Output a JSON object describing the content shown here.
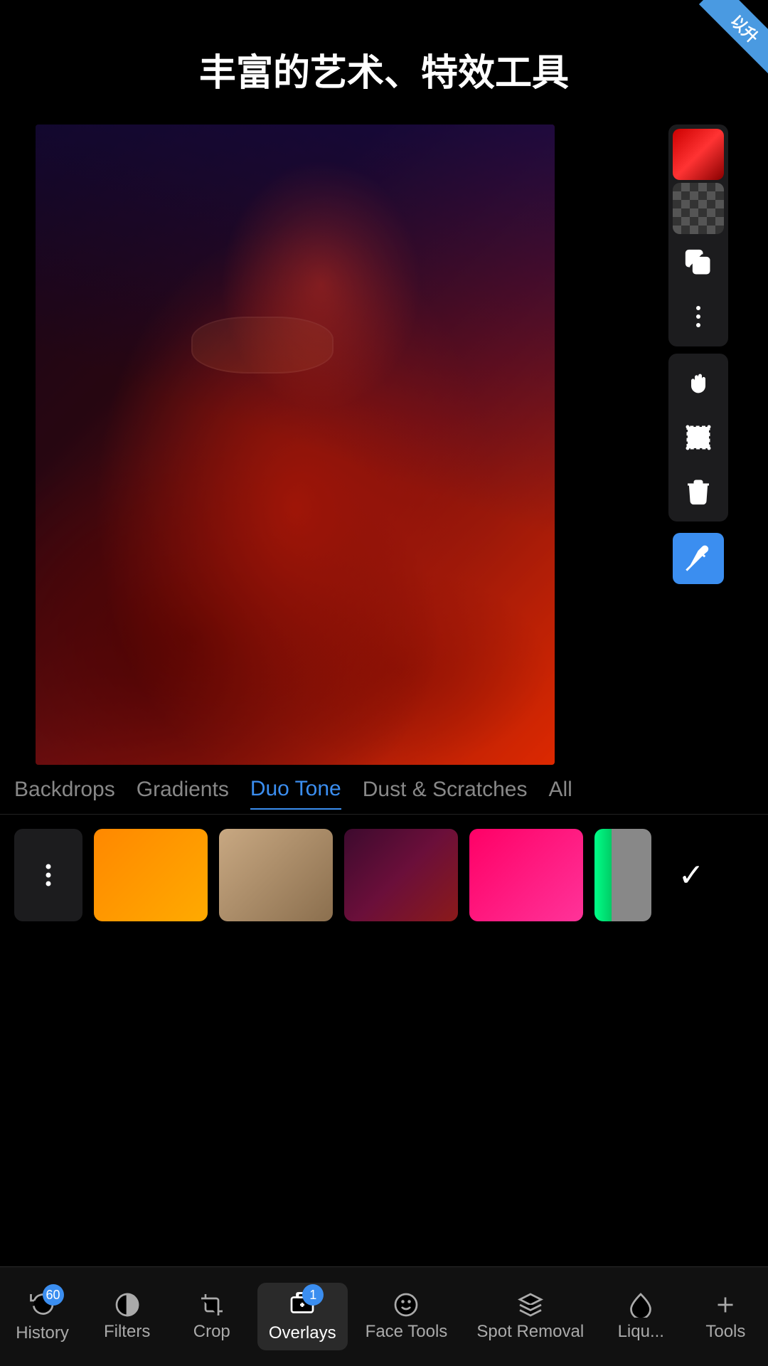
{
  "app": {
    "title": "丰富的艺术、特效工具",
    "badge_text": "以升"
  },
  "sidebar_tools_top": [
    {
      "id": "color-swatch",
      "label": "color swatch red",
      "type": "color"
    },
    {
      "id": "checker",
      "label": "checker pattern",
      "type": "checker"
    },
    {
      "id": "copy",
      "label": "copy layers",
      "type": "copy"
    },
    {
      "id": "more",
      "label": "more options",
      "type": "more"
    }
  ],
  "sidebar_tools_mid": [
    {
      "id": "hand",
      "label": "hand tool",
      "type": "hand"
    },
    {
      "id": "select",
      "label": "selection tool",
      "type": "select"
    },
    {
      "id": "delete",
      "label": "delete",
      "type": "delete"
    }
  ],
  "sidebar_tools_bottom": [
    {
      "id": "eyedropper",
      "label": "eyedropper",
      "type": "eyedrop"
    }
  ],
  "category_tabs": [
    {
      "id": "backdrops",
      "label": "Backdrops",
      "active": false
    },
    {
      "id": "gradients",
      "label": "Gradients",
      "active": false
    },
    {
      "id": "duotone",
      "label": "Duo Tone",
      "active": true
    },
    {
      "id": "dust",
      "label": "Dust & Scratches",
      "active": false
    },
    {
      "id": "all",
      "label": "All",
      "active": false
    }
  ],
  "swatches": [
    {
      "id": "more",
      "type": "more"
    },
    {
      "id": "orange",
      "type": "orange"
    },
    {
      "id": "tan",
      "type": "tan"
    },
    {
      "id": "darkred",
      "type": "darkred",
      "selected": false
    },
    {
      "id": "pink",
      "type": "pink"
    },
    {
      "id": "green",
      "type": "green"
    }
  ],
  "bottom_nav": [
    {
      "id": "history",
      "label": "History",
      "icon": "history",
      "active": false,
      "badge": "60"
    },
    {
      "id": "filters",
      "label": "Filters",
      "icon": "filters",
      "active": false
    },
    {
      "id": "crop",
      "label": "Crop",
      "icon": "crop",
      "active": false
    },
    {
      "id": "overlays",
      "label": "Overlays",
      "icon": "overlays",
      "active": true,
      "badge": "1"
    },
    {
      "id": "face-tools",
      "label": "Face Tools",
      "icon": "face",
      "active": false
    },
    {
      "id": "spot-removal",
      "label": "Spot Removal",
      "icon": "spot",
      "active": false
    },
    {
      "id": "liquify",
      "label": "Liqu...",
      "icon": "liquify",
      "active": false
    },
    {
      "id": "tools",
      "label": "Tools",
      "icon": "tools",
      "active": false
    }
  ]
}
